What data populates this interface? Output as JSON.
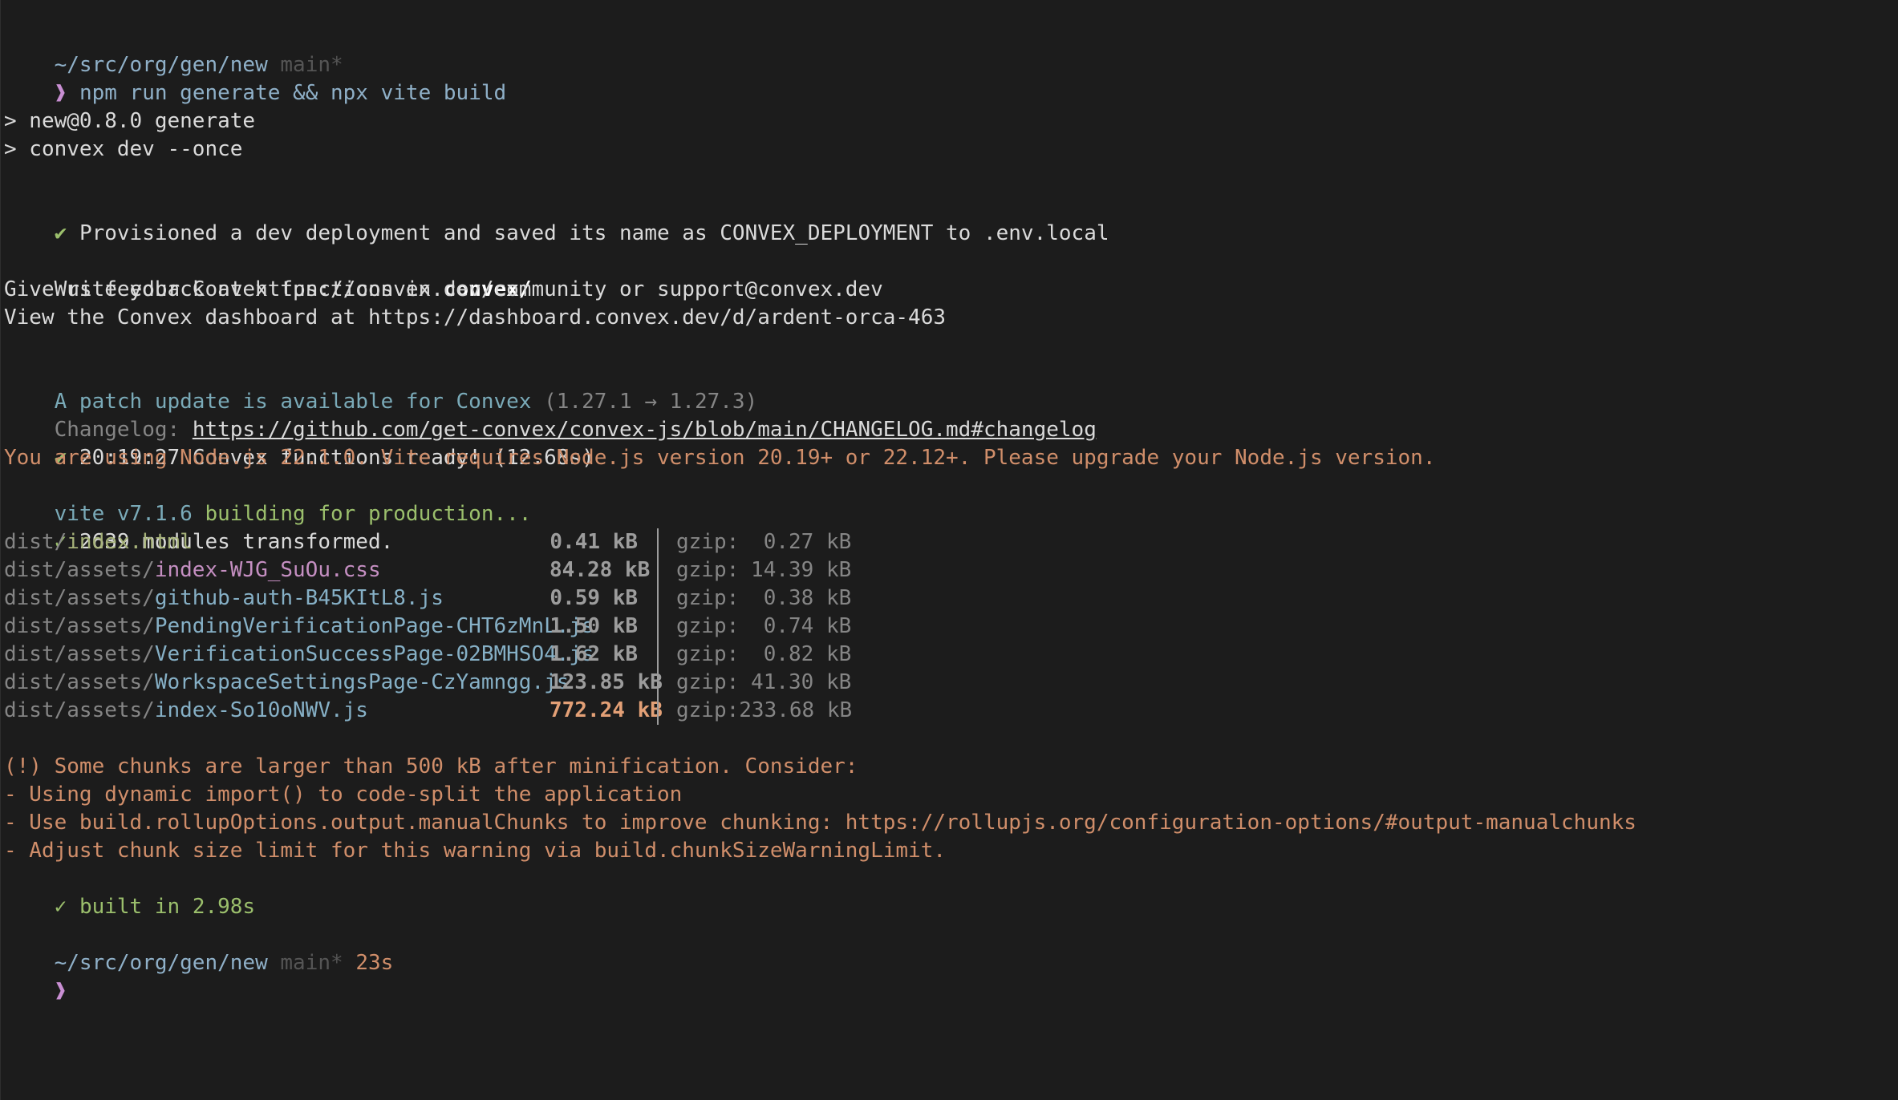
{
  "prompt": {
    "path": "~/src/org/gen/new",
    "branch": "main*",
    "symbol": "❱",
    "command": "npm run generate && npx vite build"
  },
  "npm": {
    "line1": "> new@0.8.0 generate",
    "line2": "> convex dev --once"
  },
  "convex": {
    "check": "✔",
    "provisioned": "Provisioned a dev deployment and saved its name as CONVEX_DEPLOYMENT to .env.local",
    "write_prefix": "Write your Convex functions in ",
    "write_dir": "convex/",
    "feedback": "Give us feedback at https://convex.dev/community or support@convex.dev",
    "dashboard": "View the Convex dashboard at https://dashboard.convex.dev/d/ardent-orca-463",
    "update_text": "A patch update is available for Convex ",
    "update_versions": "(1.27.1 → 1.27.3)",
    "changelog_label": "Changelog: ",
    "changelog_url": "https://github.com/get-convex/convex-js/blob/main/CHANGELOG.md#changelog",
    "ready": "20:19:27 Convex functions ready! (12.68s)"
  },
  "vite": {
    "node_warning": "You are using Node.js 22.1.0. Vite requires Node.js version 20.19+ or 22.12+. Please upgrade your Node.js version.",
    "version": "vite v7.1.6",
    "building": " building for production...",
    "check": "✓",
    "transformed": "2639 modules transformed.",
    "gzip_label": "gzip:",
    "assets": [
      {
        "dir": "dist/",
        "file": "index.html",
        "size": "0.41 kB",
        "gzip": "0.27 kB",
        "kind": "html"
      },
      {
        "dir": "dist/assets/",
        "file": "index-WJG_SuOu.css",
        "size": "84.28 kB",
        "gzip": "14.39 kB",
        "kind": "css"
      },
      {
        "dir": "dist/assets/",
        "file": "github-auth-B45KItL8.js",
        "size": "0.59 kB",
        "gzip": "0.38 kB",
        "kind": "js"
      },
      {
        "dir": "dist/assets/",
        "file": "PendingVerificationPage-CHT6zMnL.js",
        "size": "1.50 kB",
        "gzip": "0.74 kB",
        "kind": "js"
      },
      {
        "dir": "dist/assets/",
        "file": "VerificationSuccessPage-02BMHSO4.js",
        "size": "1.62 kB",
        "gzip": "0.82 kB",
        "kind": "js"
      },
      {
        "dir": "dist/assets/",
        "file": "WorkspaceSettingsPage-CzYamngg.js",
        "size": "123.85 kB",
        "gzip": "41.30 kB",
        "kind": "js"
      },
      {
        "dir": "dist/assets/",
        "file": "index-So10oNWV.js",
        "size": "772.24 kB",
        "gzip": "233.68 kB",
        "kind": "js-big"
      }
    ],
    "chunk_warning": "(!) Some chunks are larger than 500 kB after minification. Consider:",
    "tip1": "- Using dynamic import() to code-split the application",
    "tip2": "- Use build.rollupOptions.output.manualChunks to improve chunking: https://rollupjs.org/configuration-options/#output-manualchunks",
    "tip3": "- Adjust chunk size limit for this warning via build.chunkSizeWarningLimit.",
    "built": "built in 2.98s"
  },
  "prompt2": {
    "path": "~/src/org/gen/new",
    "branch": "main*",
    "duration": "23s",
    "symbol": "❱"
  },
  "colors": {
    "background": "#1c1c1c",
    "path": "#8fb0c8",
    "prompt": "#c98fd3",
    "success": "#9bbf6c",
    "warning": "#d08e6a"
  }
}
